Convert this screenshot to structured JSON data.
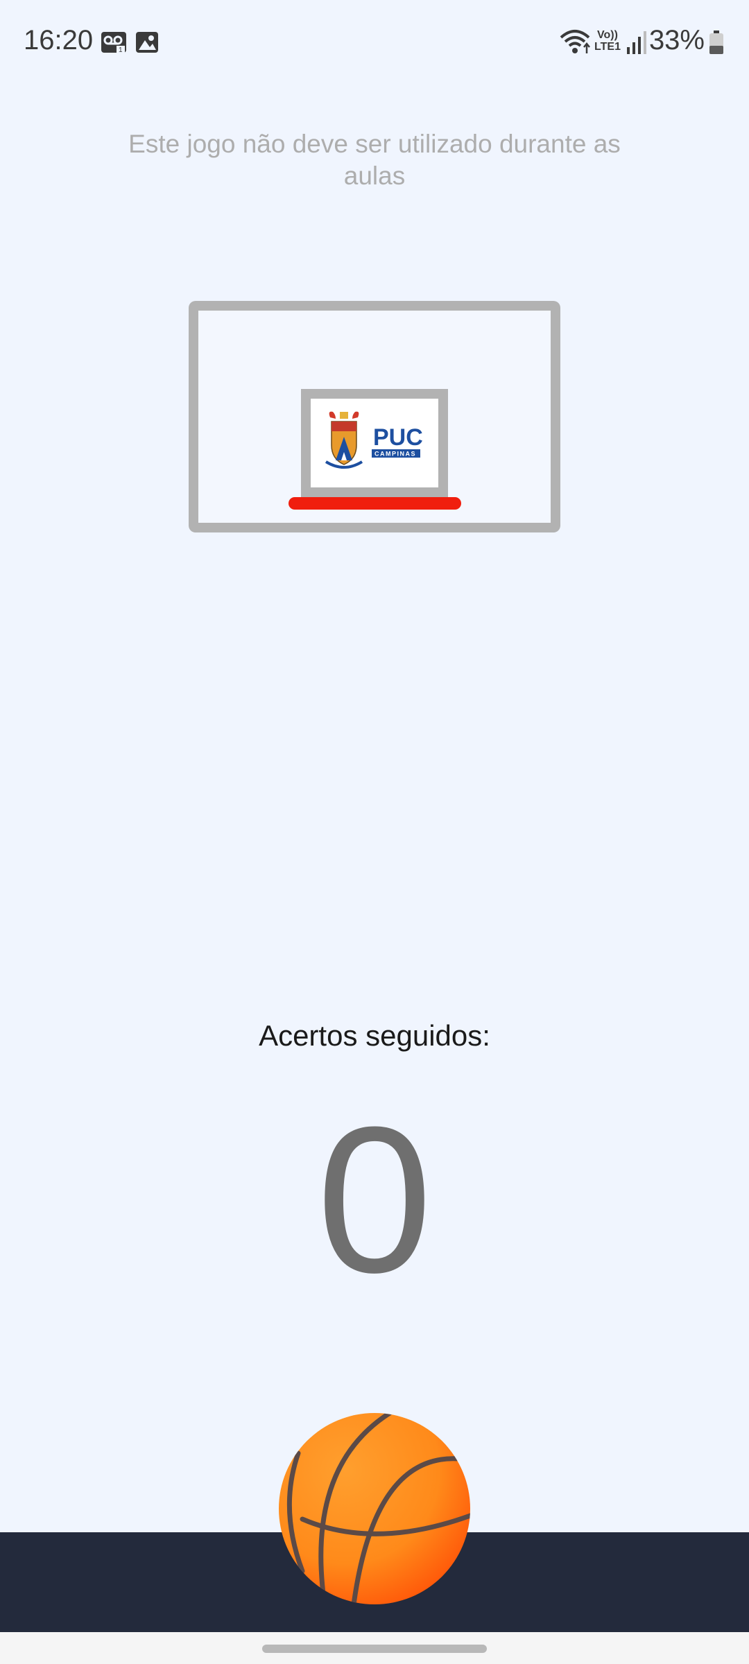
{
  "status_bar": {
    "time": "16:20",
    "network_label_top": "Vo))",
    "network_label_bottom": "LTE1",
    "battery_percent": "33%",
    "icons": [
      "voicemail-icon",
      "image-icon",
      "wifi-icon",
      "signal-icon",
      "battery-icon"
    ]
  },
  "game": {
    "notice": "Este jogo não deve ser utilizado durante as aulas",
    "logo_text": "PUC",
    "logo_subtext": "CAMPINAS",
    "streak_label": "Acertos seguidos:",
    "streak_value": "0"
  },
  "colors": {
    "background": "#f0f5fe",
    "backboard": "#b2b2b2",
    "rim": "#f01e0e",
    "floor": "#232a3c",
    "ball": "#ff8a1e",
    "logo_blue": "#1d4fa0"
  }
}
